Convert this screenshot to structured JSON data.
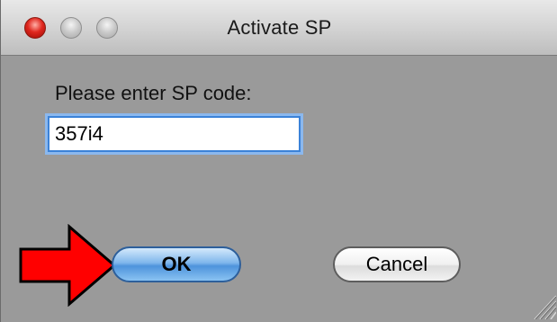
{
  "window": {
    "title": "Activate SP"
  },
  "dialog": {
    "prompt": "Please enter SP code:",
    "code_value": "357i4",
    "ok_label": "OK",
    "cancel_label": "Cancel"
  },
  "icons": {
    "close": "close-icon",
    "minimize": "minimize-icon",
    "zoom": "zoom-icon",
    "annotation": "red-arrow-icon",
    "resize": "resize-grip-icon"
  },
  "colors": {
    "close_red": "#e0281f",
    "focus_blue": "#3b82d8",
    "default_button_blue": "#6ba8e8",
    "arrow_red": "#ff0000",
    "window_body": "#9a9a9a"
  }
}
